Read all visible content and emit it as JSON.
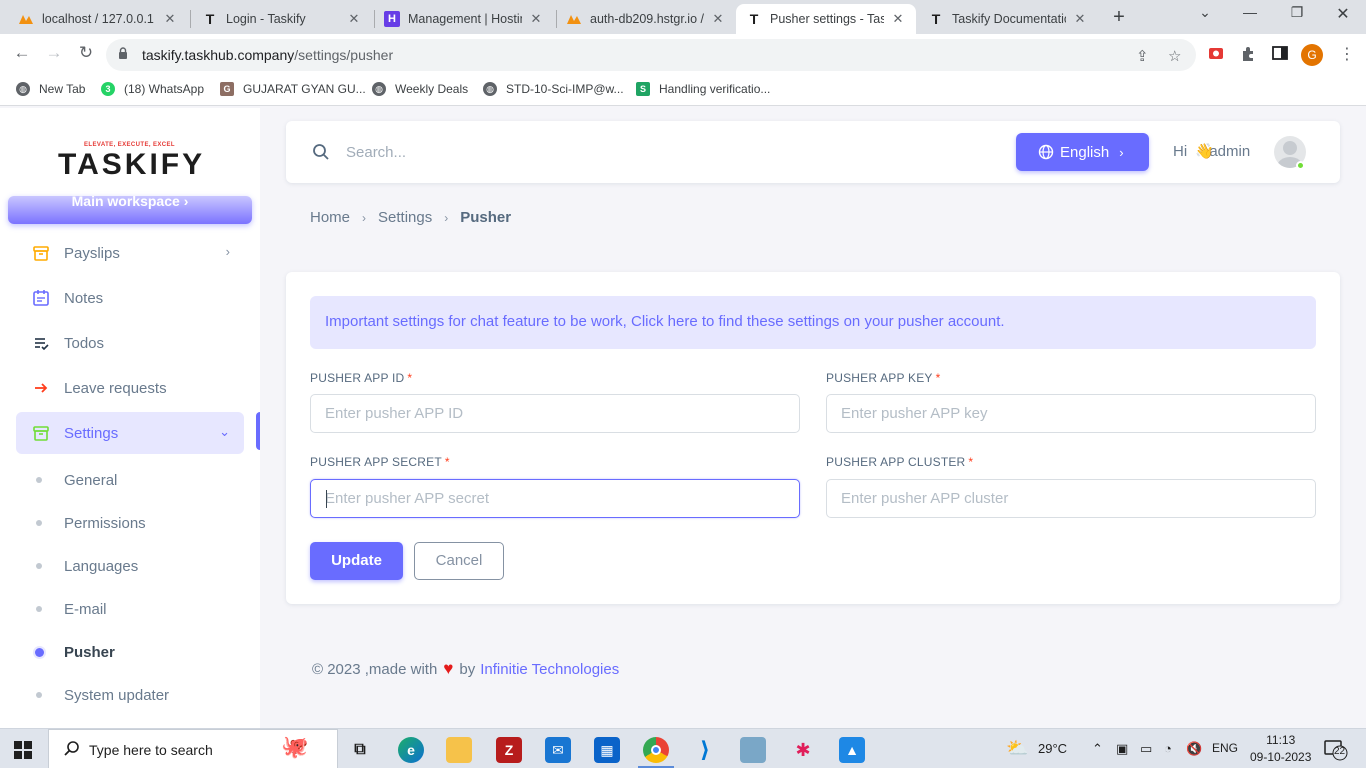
{
  "browser": {
    "tabs": [
      {
        "title": "localhost / 127.0.0.1 /",
        "favicon": "phpmyadmin-icon",
        "active": false
      },
      {
        "title": "Login - Taskify",
        "favicon": "taskify-icon",
        "active": false
      },
      {
        "title": "Management | Hostin",
        "favicon": "hostinger-icon",
        "active": false
      },
      {
        "title": "auth-db209.hstgr.io /",
        "favicon": "phpmyadmin-icon",
        "active": false
      },
      {
        "title": "Pusher settings - Task",
        "favicon": "taskify-icon",
        "active": true
      },
      {
        "title": "Taskify Documentatio",
        "favicon": "taskify-icon",
        "active": false
      }
    ],
    "url_host": "taskify.taskhub.company",
    "url_path": "/settings/pusher",
    "profile_initial": "G",
    "bookmarks": [
      {
        "label": "New Tab",
        "icon": "globe-icon"
      },
      {
        "label": "(18) WhatsApp",
        "icon": "whatsapp-icon",
        "badge": "3"
      },
      {
        "label": "GUJARAT GYAN GU...",
        "icon": "site-icon"
      },
      {
        "label": "Weekly Deals",
        "icon": "globe-icon"
      },
      {
        "label": "STD-10-Sci-IMP@w...",
        "icon": "globe-icon"
      },
      {
        "label": "Handling verificatio...",
        "icon": "s-icon"
      }
    ]
  },
  "sidebar": {
    "logo_tagline": "ELEVATE, EXECUTE, EXCEL",
    "logo_word": "TASKIFY",
    "workspace_label": "Main workspace",
    "items": [
      {
        "label": "Payslips",
        "icon": "archive-icon",
        "has_chevron": true
      },
      {
        "label": "Notes",
        "icon": "calendar-note-icon"
      },
      {
        "label": "Todos",
        "icon": "list-check-icon"
      },
      {
        "label": "Leave requests",
        "icon": "arrow-right-icon"
      },
      {
        "label": "Settings",
        "icon": "box-icon",
        "active": true,
        "expanded": true
      }
    ],
    "sub_items": [
      {
        "label": "General"
      },
      {
        "label": "Permissions"
      },
      {
        "label": "Languages"
      },
      {
        "label": "E-mail"
      },
      {
        "label": "Pusher",
        "active": true
      },
      {
        "label": "System updater"
      }
    ]
  },
  "navbar": {
    "search_placeholder": "Search...",
    "language_label": "English",
    "greeting_prefix": "Hi",
    "greeting_name": ",admin"
  },
  "breadcrumb": {
    "home": "Home",
    "settings": "Settings",
    "current": "Pusher"
  },
  "form": {
    "alert": "Important settings for chat feature to be work, Click here to find these settings on your pusher account.",
    "fields": {
      "app_id": {
        "label": "PUSHER APP ID",
        "placeholder": "Enter pusher APP ID",
        "value": ""
      },
      "app_key": {
        "label": "PUSHER APP KEY",
        "placeholder": "Enter pusher APP key",
        "value": ""
      },
      "app_secret": {
        "label": "PUSHER APP SECRET",
        "placeholder": "Enter pusher APP secret",
        "value": "",
        "focused": true
      },
      "app_cluster": {
        "label": "PUSHER APP CLUSTER",
        "placeholder": "Enter pusher APP cluster",
        "value": ""
      }
    },
    "required_mark": "*",
    "update_label": "Update",
    "cancel_label": "Cancel"
  },
  "footer": {
    "prefix": "© 2023 ,made with",
    "by": "by",
    "company": "Infinitie Technologies"
  },
  "taskbar": {
    "search_placeholder": "Type here to search",
    "weather": "29°C",
    "language": "ENG",
    "time": "11:13",
    "date": "09-10-2023",
    "notifications": "22"
  },
  "colors": {
    "primary": "#696cff",
    "primary_light": "#e7e7ff",
    "danger": "#ff3e1d",
    "text": "#697a8d"
  }
}
